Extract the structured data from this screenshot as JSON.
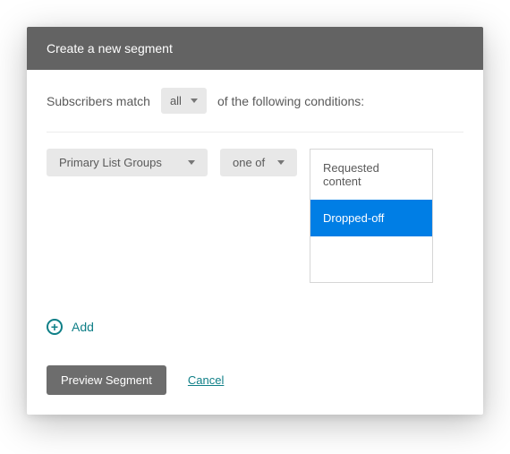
{
  "header": {
    "title": "Create a new segment"
  },
  "match": {
    "prefix": "Subscribers match",
    "mode": "all",
    "suffix": "of the following conditions:"
  },
  "condition": {
    "field": "Primary List Groups",
    "operator": "one of",
    "options": [
      {
        "label": "Requested content",
        "selected": false
      },
      {
        "label": "Dropped-off",
        "selected": true
      }
    ]
  },
  "actions": {
    "add": "Add",
    "preview": "Preview Segment",
    "cancel": "Cancel"
  }
}
